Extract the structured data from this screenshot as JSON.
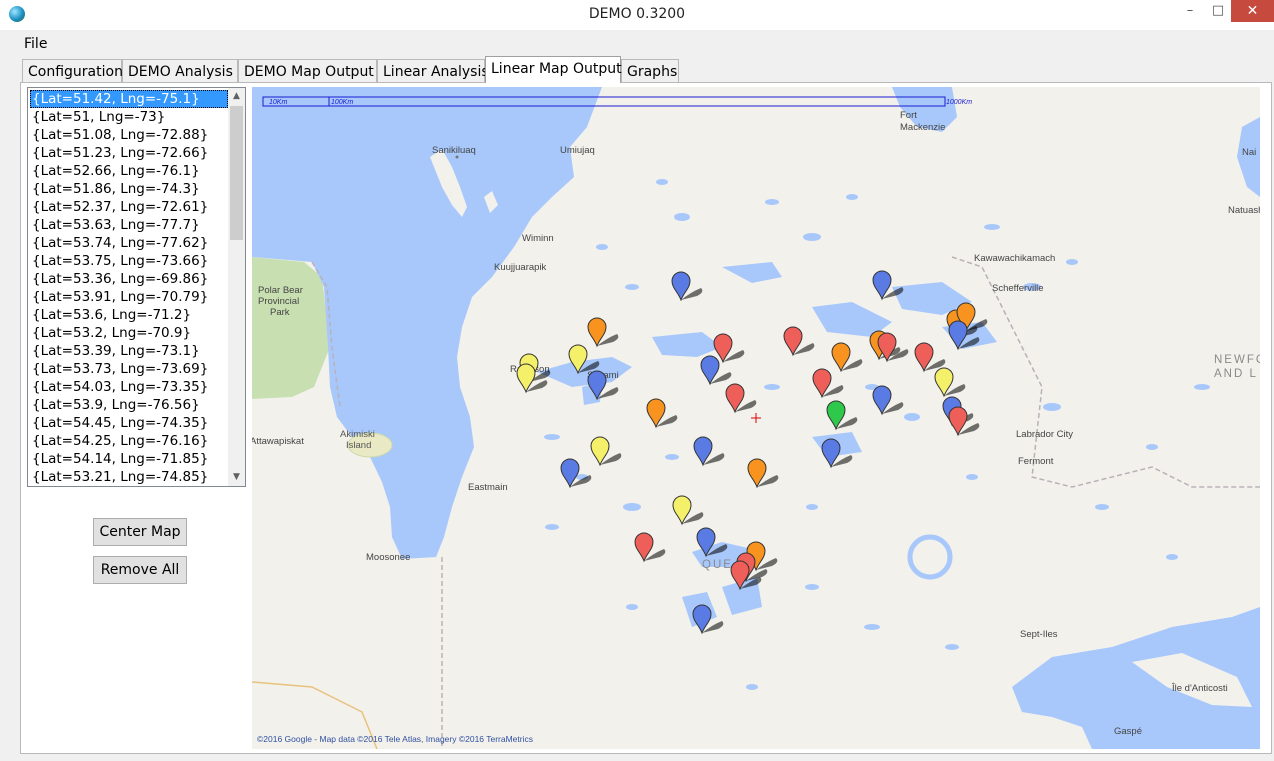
{
  "window": {
    "title": "DEMO 0.3200",
    "minimize_glyph": "–",
    "maximize_glyph": "□",
    "close_glyph": "✕"
  },
  "menu": {
    "file": "File"
  },
  "tabs": [
    "Configuration",
    "DEMO Analysis",
    "DEMO Map Output",
    "Linear Analysis",
    "Linear Map Output",
    "Graphs"
  ],
  "active_tab": "Linear Map Output",
  "coordinates": [
    "{Lat=51.42, Lng=-75.1}",
    "{Lat=51, Lng=-73}",
    "{Lat=51.08, Lng=-72.88}",
    "{Lat=51.23, Lng=-72.66}",
    "{Lat=52.66, Lng=-76.1}",
    "{Lat=51.86, Lng=-74.3}",
    "{Lat=52.37, Lng=-72.61}",
    "{Lat=53.63, Lng=-77.7}",
    "{Lat=53.74, Lng=-77.62}",
    "{Lat=53.75, Lng=-73.66}",
    "{Lat=53.36, Lng=-69.86}",
    "{Lat=53.91, Lng=-70.79}",
    "{Lat=53.6, Lng=-71.2}",
    "{Lat=53.2, Lng=-70.9}",
    "{Lat=53.39, Lng=-73.1}",
    "{Lat=53.73, Lng=-73.69}",
    "{Lat=54.03, Lng=-73.35}",
    "{Lat=53.9, Lng=-76.56}",
    "{Lat=54.45, Lng=-74.35}",
    "{Lat=54.25, Lng=-76.16}",
    "{Lat=54.14, Lng=-71.85}",
    "{Lat=53.21, Lng=-74.85}"
  ],
  "selected_coordinate": "{Lat=51.42, Lng=-75.1}",
  "buttons": {
    "center_map": "Center Map",
    "remove_all": "Remove All"
  },
  "scrollbar": {
    "up_glyph": "▲",
    "down_glyph": "▼"
  },
  "map": {
    "scale": {
      "label_10": "10Km",
      "label_100": "100Km",
      "label_1000": "1000Km"
    },
    "places": {
      "fort": "Fort",
      "mackenzie": "Mackenzie",
      "sanikiluaq": "Sanikiluaq",
      "umiujaq": "Umiujaq",
      "wiminn": "Wiminn",
      "kuujjuarapik": "Kuujjuarapik",
      "polar": "Polar Bear",
      "provincial": "Provincial",
      "park": "Park",
      "kawawachikamach": "Kawawachikamach",
      "schefferville": "Schefferville",
      "newfo": "NEWFO",
      "and_l": "AND L",
      "nain": "Nai",
      "natuash": "Natuash",
      "radisson": "Radisson",
      "lg_town": "Sakami",
      "attawapiskat": "Attawapiskat",
      "akimiski": "Akimiski",
      "island": "Island",
      "labrador_city": "Labrador City",
      "fermont": "Fermont",
      "eastmain": "Eastmain",
      "moosonee": "Moosonee",
      "quebec": "QUE",
      "sept_iles": "Sept-Iles",
      "anticosti": "Île d'Anticosti",
      "gaspe": "Gaspé"
    },
    "copyright": "©2016 Google - Map data ©2016 Tele Atlas, Imagery ©2016 TerraMetrics",
    "marker_colors": {
      "blue": "#5a7be3",
      "orange": "#f7931e",
      "red": "#ef5f5a",
      "yellow": "#f5f06a",
      "green": "#2ec94a"
    }
  }
}
